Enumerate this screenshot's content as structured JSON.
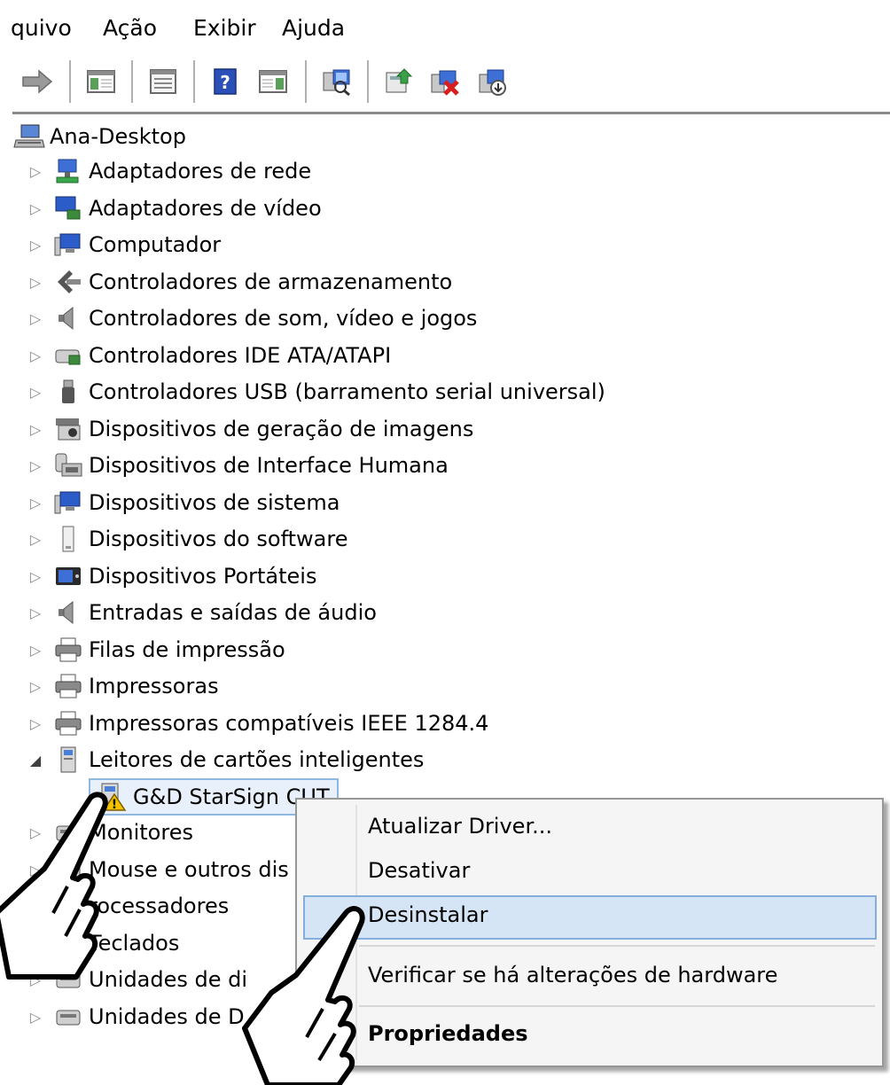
{
  "menubar": {
    "items": [
      "quivo",
      "Ação",
      "Exibir",
      "Ajuda"
    ]
  },
  "toolbar": {
    "icons": [
      "forward-arrow-icon",
      "show-hide-console-tree-icon",
      "properties-icon",
      "help-icon",
      "action-pane-icon",
      "scan-hardware-icon",
      "update-driver-icon",
      "uninstall-icon",
      "disable-device-icon"
    ]
  },
  "tree": {
    "root": "Ana-Desktop",
    "categories": [
      {
        "label": "Adaptadores de rede",
        "icon": "network-adapter-icon"
      },
      {
        "label": "Adaptadores de vídeo",
        "icon": "display-adapter-icon"
      },
      {
        "label": "Computador",
        "icon": "computer-icon"
      },
      {
        "label": "Controladores de armazenamento",
        "icon": "storage-controller-icon"
      },
      {
        "label": "Controladores de som, vídeo e jogos",
        "icon": "speaker-icon"
      },
      {
        "label": "Controladores IDE ATA/ATAPI",
        "icon": "ide-controller-icon"
      },
      {
        "label": "Controladores USB (barramento serial universal)",
        "icon": "usb-icon"
      },
      {
        "label": "Dispositivos de geração de imagens",
        "icon": "imaging-device-icon"
      },
      {
        "label": "Dispositivos de Interface Humana",
        "icon": "hid-icon"
      },
      {
        "label": "Dispositivos de sistema",
        "icon": "system-device-icon"
      },
      {
        "label": "Dispositivos do software",
        "icon": "software-device-icon"
      },
      {
        "label": "Dispositivos Portáteis",
        "icon": "portable-device-icon"
      },
      {
        "label": "Entradas e saídas de áudio",
        "icon": "audio-io-icon"
      },
      {
        "label": "Filas de impressão",
        "icon": "print-queue-icon"
      },
      {
        "label": "Impressoras",
        "icon": "printer-icon"
      },
      {
        "label": "Impressoras compatíveis IEEE 1284.4",
        "icon": "printer-icon"
      },
      {
        "label": "Leitores de cartões inteligentes",
        "icon": "smart-card-reader-icon"
      }
    ],
    "selected_child": "G&D StarSign CUT",
    "more_categories": [
      {
        "label": "Monitores"
      },
      {
        "label": "Mouse e outros dis"
      },
      {
        "label": "rocessadores"
      },
      {
        "label": "Teclados"
      },
      {
        "label": "Unidades de di"
      },
      {
        "label": "Unidades de D"
      }
    ]
  },
  "context_menu": {
    "items": [
      "Atualizar Driver...",
      "Desativar",
      "Desinstalar",
      "Verificar se há alterações de hardware",
      "Propriedades"
    ]
  },
  "colors": {
    "selection_fill": "#e8f1fb",
    "selection_border": "#8fb8e0",
    "menu_highlight": "#d5e5f6",
    "menu_highlight_border": "#86aedc",
    "warning": "#f2c200"
  }
}
